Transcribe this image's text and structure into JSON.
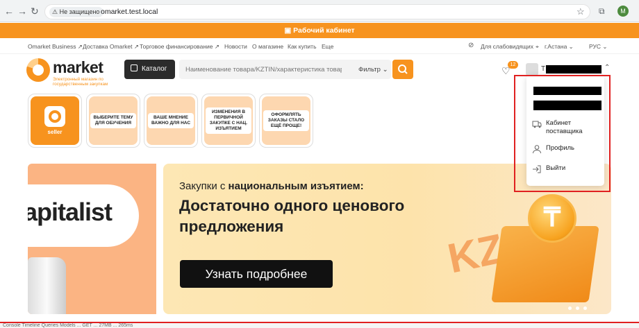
{
  "browser": {
    "security_label": "Не защищено",
    "url": "omarket.test.local",
    "profile_initial": "M"
  },
  "top_bar": {
    "label": "Рабочий кабинет"
  },
  "top_nav": {
    "links": [
      "Omarket Business ↗",
      "Доставка Omarket ↗",
      "Торговое финансирование ↗",
      "Новости",
      "О магазине",
      "Как купить",
      "Еще"
    ],
    "accessibility": "Для слабовидящих",
    "city": "г.Астана",
    "language": "РУС"
  },
  "header": {
    "logo_word": "market",
    "logo_subtitle": "Электронный магазин по государственным закупкам",
    "catalog_label": "Каталог",
    "search_placeholder": "Наименование товара/KZTIN/характеристика товара",
    "filter_label": "Фильтр",
    "favorites_count": "12",
    "user_initial": "Т"
  },
  "tiles": [
    {
      "label": "seller"
    },
    {
      "label": "ВЫБЕРИТЕ ТЕМУ ДЛЯ ОБУЧЕНИЯ"
    },
    {
      "label": "ВАШЕ МНЕНИЕ ВАЖНО ДЛЯ НАС"
    },
    {
      "label": "ИЗМЕНЕНИЯ В ПЕРВИЧНОЙ ЗАКУПКЕ С НАЦ. ИЗЪЯТИЕМ"
    },
    {
      "label": "ОФОРМЛЯТЬ ЗАКАЗЫ СТАЛО ЕЩЁ ПРОЩЕ!"
    }
  ],
  "banner_left": {
    "text": "apitalist"
  },
  "banner": {
    "line1_prefix": "Закупки с ",
    "line1_bold": "национальным изъятием:",
    "headline": "Достаточно одного ценового предложения",
    "button": "Узнать подробнее",
    "coin_symbol": "₸",
    "kzt": "KZ"
  },
  "user_menu": {
    "items": [
      {
        "label": "Кабинет поставщика",
        "icon": "truck-icon"
      },
      {
        "label": "Профиль",
        "icon": "user-icon"
      },
      {
        "label": "Выйти",
        "icon": "logout-icon"
      }
    ]
  },
  "devtools": {
    "text": "Console  Timeline  Queries  Models  ...  GET  ...  27MB  ...  265ms"
  }
}
